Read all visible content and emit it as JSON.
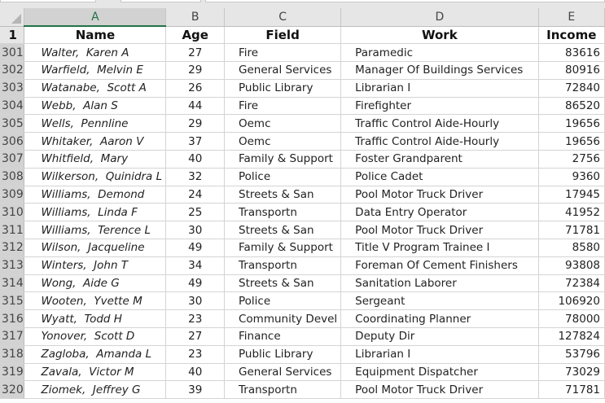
{
  "columns": [
    "A",
    "B",
    "C",
    "D",
    "E"
  ],
  "header_row": {
    "num": "1",
    "name": "Name",
    "age": "Age",
    "field": "Field",
    "work": "Work",
    "income": "Income"
  },
  "rows": [
    {
      "num": "301",
      "name": "Walter,  Karen A",
      "age": "27",
      "field": "Fire",
      "work": "Paramedic",
      "income": "83616"
    },
    {
      "num": "302",
      "name": "Warfield,  Melvin E",
      "age": "29",
      "field": "General Services",
      "work": "Manager Of Buildings Services",
      "income": "80916"
    },
    {
      "num": "303",
      "name": "Watanabe,  Scott A",
      "age": "26",
      "field": "Public Library",
      "work": "Librarian I",
      "income": "72840"
    },
    {
      "num": "304",
      "name": "Webb,  Alan S",
      "age": "44",
      "field": "Fire",
      "work": "Firefighter",
      "income": "86520"
    },
    {
      "num": "305",
      "name": "Wells,  Pennline",
      "age": "29",
      "field": "Oemc",
      "work": "Traffic Control Aide-Hourly",
      "income": "19656"
    },
    {
      "num": "306",
      "name": "Whitaker,  Aaron V",
      "age": "37",
      "field": "Oemc",
      "work": "Traffic Control Aide-Hourly",
      "income": "19656"
    },
    {
      "num": "307",
      "name": "Whitfield,  Mary",
      "age": "40",
      "field": "Family & Support",
      "work": "Foster Grandparent",
      "income": "2756"
    },
    {
      "num": "308",
      "name": "Wilkerson,  Quinidra L",
      "age": "32",
      "field": "Police",
      "work": "Police Cadet",
      "income": "9360"
    },
    {
      "num": "309",
      "name": "Williams,  Demond",
      "age": "24",
      "field": "Streets & San",
      "work": "Pool Motor Truck Driver",
      "income": "17945"
    },
    {
      "num": "310",
      "name": "Williams,  Linda F",
      "age": "25",
      "field": "Transportn",
      "work": "Data Entry Operator",
      "income": "41952"
    },
    {
      "num": "311",
      "name": "Williams,  Terence L",
      "age": "30",
      "field": "Streets & San",
      "work": "Pool Motor Truck Driver",
      "income": "71781"
    },
    {
      "num": "312",
      "name": "Wilson,  Jacqueline",
      "age": "49",
      "field": "Family & Support",
      "work": "Title V Program Trainee I",
      "income": "8580"
    },
    {
      "num": "313",
      "name": "Winters,  John T",
      "age": "34",
      "field": "Transportn",
      "work": "Foreman Of Cement Finishers",
      "income": "93808"
    },
    {
      "num": "314",
      "name": "Wong,  Aide G",
      "age": "49",
      "field": "Streets & San",
      "work": "Sanitation Laborer",
      "income": "72384"
    },
    {
      "num": "315",
      "name": "Wooten,  Yvette M",
      "age": "30",
      "field": "Police",
      "work": "Sergeant",
      "income": "106920"
    },
    {
      "num": "316",
      "name": "Wyatt,  Todd H",
      "age": "23",
      "field": "Community Devel",
      "work": "Coordinating Planner",
      "income": "78000"
    },
    {
      "num": "317",
      "name": "Yonover,  Scott D",
      "age": "27",
      "field": "Finance",
      "work": "Deputy Dir",
      "income": "127824"
    },
    {
      "num": "318",
      "name": "Zagloba,  Amanda L",
      "age": "23",
      "field": "Public Library",
      "work": "Librarian I",
      "income": "53796"
    },
    {
      "num": "319",
      "name": "Zavala,  Victor M",
      "age": "40",
      "field": "General Services",
      "work": "Equipment Dispatcher",
      "income": "73029"
    },
    {
      "num": "320",
      "name": "Ziomek,  Jeffrey G",
      "age": "39",
      "field": "Transportn",
      "work": "Pool Motor Truck Driver",
      "income": "71781"
    }
  ]
}
